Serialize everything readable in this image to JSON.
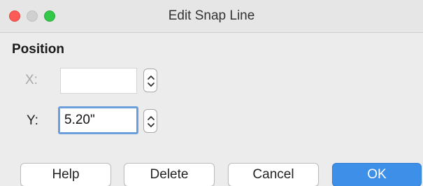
{
  "window": {
    "title": "Edit Snap Line",
    "controls": [
      "close-icon",
      "minimize-icon",
      "zoom-icon"
    ]
  },
  "position": {
    "section_label": "Position",
    "x_label": "X:",
    "x_value": "",
    "y_label": "Y:",
    "y_value": "5.20\""
  },
  "buttons": {
    "help": "Help",
    "delete": "Delete",
    "cancel": "Cancel",
    "ok": "OK"
  },
  "colors": {
    "accent": "#3d8fe8",
    "focus_ring": "#6a9fdc",
    "close": "#fc5b57",
    "zoom": "#34c84a"
  }
}
